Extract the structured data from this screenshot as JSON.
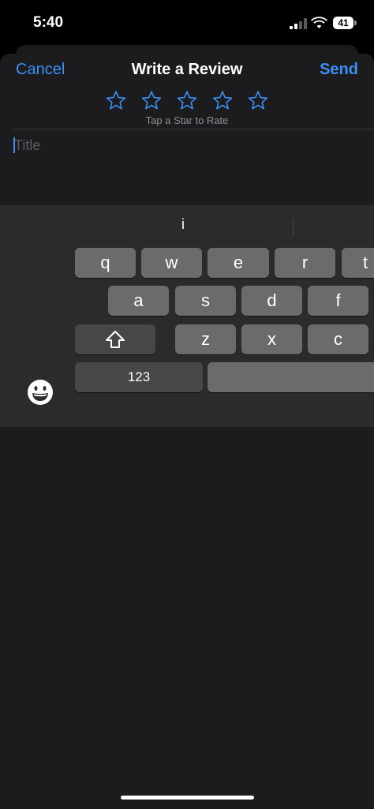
{
  "status_bar": {
    "time": "5:40",
    "battery_level": "41",
    "icons": [
      "signal-icon",
      "wifi-icon",
      "battery-icon"
    ]
  },
  "nav": {
    "cancel_label": "Cancel",
    "title": "Write a Review",
    "send_label": "Send"
  },
  "rating": {
    "star_count": 5,
    "selected": 0,
    "hint": "Tap a Star to Rate",
    "icon": "star-outline-icon"
  },
  "form": {
    "title_placeholder": "Title",
    "title_value": ""
  },
  "keyboard": {
    "suggestion": "i",
    "row1": [
      "q",
      "w",
      "e",
      "r",
      "t"
    ],
    "row2": [
      "a",
      "s",
      "d",
      "f"
    ],
    "row3": [
      "z",
      "x",
      "c"
    ],
    "numbers_label": "123",
    "icons": [
      "shift-icon",
      "emoji-icon"
    ]
  },
  "colors": {
    "accent": "#3a8ff5",
    "sheet_background": "#1c1c1e",
    "keyboard_background": "#2b2b2d",
    "key": "#6b6b6e"
  }
}
